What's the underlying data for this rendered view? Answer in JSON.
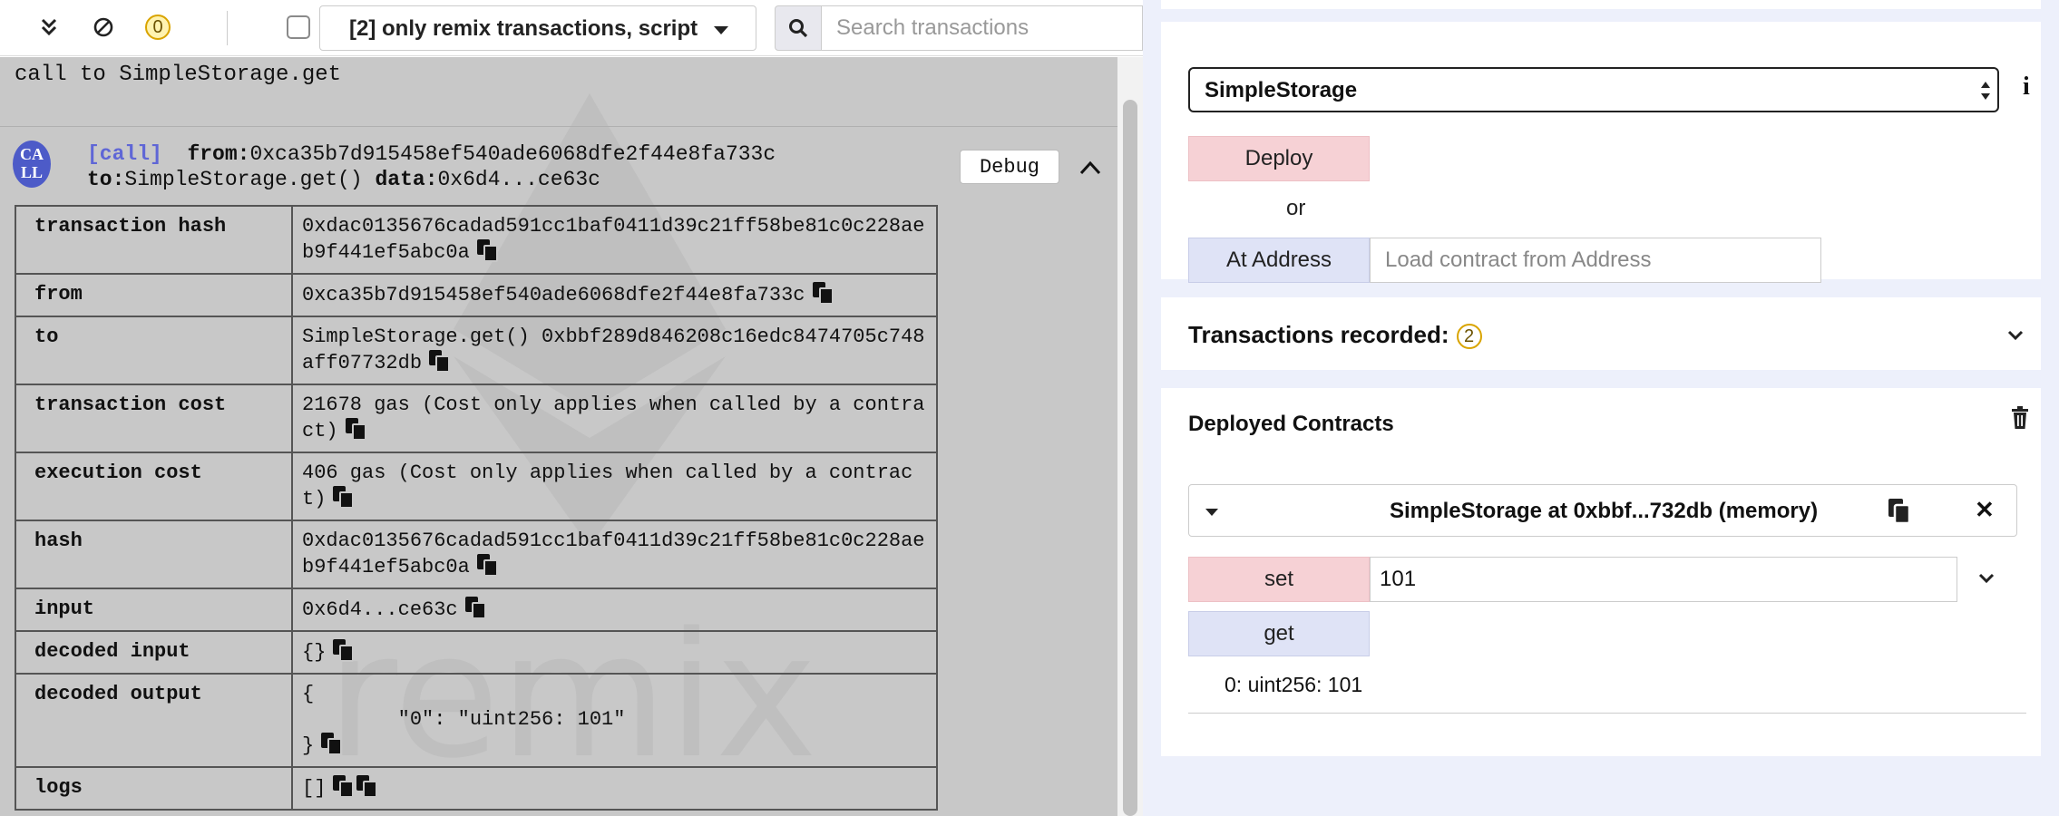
{
  "toolbar": {
    "pending_count": "0",
    "filter_selected": "[2] only remix transactions, script",
    "search_placeholder": "Search transactions"
  },
  "terminal": {
    "call_message": "call to SimpleStorage.get",
    "avatar_text": "CA LL",
    "tx": {
      "tag": "[call]",
      "from_label": "from:",
      "from_value": "0xca35b7d915458ef540ade6068dfe2f44e8fa733c",
      "to_label": "to:",
      "to_value": "SimpleStorage.get()",
      "data_label": "data:",
      "data_value": "0x6d4...ce63c"
    },
    "debug_label": "Debug",
    "rows": {
      "transaction_hash": {
        "key": "transaction hash",
        "value": "0xdac0135676cadad591cc1baf0411d39c21ff58be81c0c228aeb9f441ef5abc0a"
      },
      "from": {
        "key": "from",
        "value": "0xca35b7d915458ef540ade6068dfe2f44e8fa733c"
      },
      "to": {
        "key": "to",
        "value": "SimpleStorage.get() 0xbbf289d846208c16edc8474705c748aff07732db"
      },
      "transaction_cost": {
        "key": "transaction cost",
        "value": "21678 gas (Cost only applies when called by a contract)"
      },
      "execution_cost": {
        "key": "execution cost",
        "value": "406 gas (Cost only applies when called by a contract)"
      },
      "hash": {
        "key": "hash",
        "value": "0xdac0135676cadad591cc1baf0411d39c21ff58be81c0c228aeb9f441ef5abc0a"
      },
      "input": {
        "key": "input",
        "value": "0x6d4...ce63c"
      },
      "decoded_input": {
        "key": "decoded input",
        "value": "{}"
      },
      "decoded_output": {
        "key": "decoded output",
        "value": "{\n\t\"0\": \"uint256: 101\"\n}"
      },
      "logs": {
        "key": "logs",
        "value": "[]"
      }
    }
  },
  "run_panel": {
    "contract_selected": "SimpleStorage",
    "deploy_label": "Deploy",
    "or_label": "or",
    "at_address_label": "At Address",
    "address_placeholder": "Load contract from Address",
    "transactions_recorded_label": "Transactions recorded:",
    "transactions_recorded_count": "2",
    "deployed_contracts_label": "Deployed Contracts",
    "instance_title": "SimpleStorage at 0xbbf...732db (memory)",
    "set_label": "set",
    "set_value": "101",
    "get_label": "get",
    "get_result": "0: uint256: 101"
  },
  "icons": {
    "expand": "double-chevron-down-icon",
    "clear": "ban-icon",
    "search": "search-icon",
    "collapse": "chevron-up-icon",
    "copy": "copy-icon",
    "info": "info-icon",
    "trash": "trash-icon",
    "close": "close-icon"
  },
  "colors": {
    "deploy_bg": "#f6d1d5",
    "call_bg": "#dfe3f6",
    "panel_bg": "#edf0fb",
    "terminal_bg": "#c8c8c8",
    "badge": "#d9a400",
    "call_tag": "#5f66d6"
  }
}
